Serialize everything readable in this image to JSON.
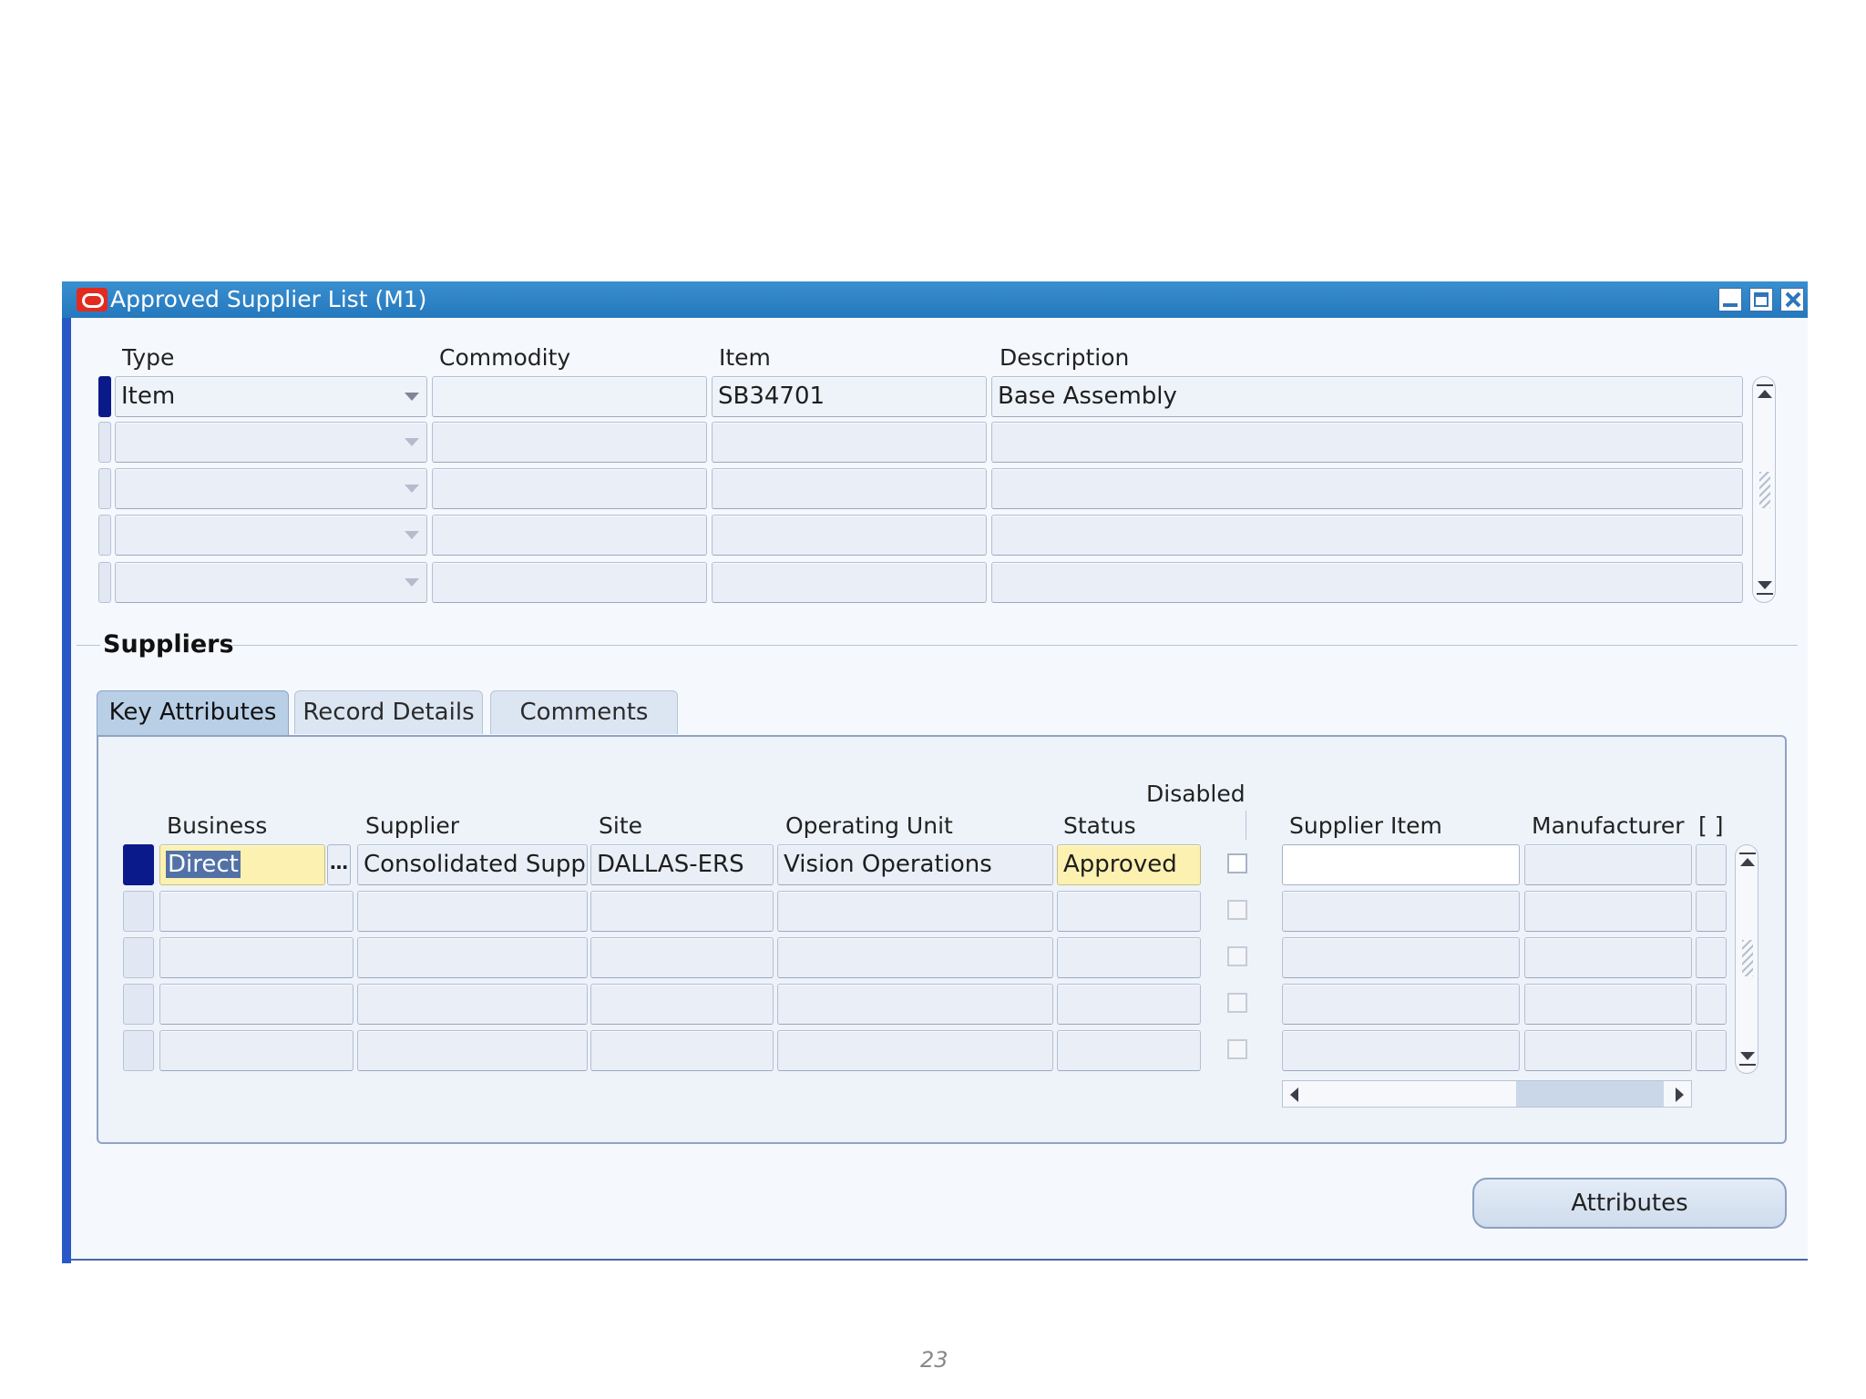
{
  "window": {
    "title": "Approved Supplier List (M1)"
  },
  "top_block": {
    "columns": {
      "type": "Type",
      "commodity": "Commodity",
      "item": "Item",
      "description": "Description"
    },
    "rows": [
      {
        "type": "Item",
        "commodity": "",
        "item": "SB34701",
        "description": "Base Assembly"
      },
      {
        "type": "",
        "commodity": "",
        "item": "",
        "description": ""
      },
      {
        "type": "",
        "commodity": "",
        "item": "",
        "description": ""
      },
      {
        "type": "",
        "commodity": "",
        "item": "",
        "description": ""
      },
      {
        "type": "",
        "commodity": "",
        "item": "",
        "description": ""
      }
    ]
  },
  "suppliers": {
    "section_title": "Suppliers",
    "tabs": [
      "Key Attributes",
      "Record Details",
      "Comments"
    ],
    "active_tab": "Key Attributes",
    "columns": {
      "business": "Business",
      "supplier": "Supplier",
      "site": "Site",
      "operating_unit": "Operating Unit",
      "status": "Status",
      "disabled": "Disabled",
      "supplier_item": "Supplier Item",
      "manufacturer": "Manufacturer",
      "extra": "[ ]"
    },
    "lov_glyph": "…",
    "rows": [
      {
        "business": "Direct",
        "supplier": "Consolidated Suppli",
        "site": "DALLAS-ERS",
        "operating_unit": "Vision Operations",
        "status": "Approved",
        "disabled": false,
        "supplier_item": "",
        "manufacturer": ""
      },
      {
        "business": "",
        "supplier": "",
        "site": "",
        "operating_unit": "",
        "status": "",
        "disabled": false,
        "supplier_item": "",
        "manufacturer": ""
      },
      {
        "business": "",
        "supplier": "",
        "site": "",
        "operating_unit": "",
        "status": "",
        "disabled": false,
        "supplier_item": "",
        "manufacturer": ""
      },
      {
        "business": "",
        "supplier": "",
        "site": "",
        "operating_unit": "",
        "status": "",
        "disabled": false,
        "supplier_item": "",
        "manufacturer": ""
      },
      {
        "business": "",
        "supplier": "",
        "site": "",
        "operating_unit": "",
        "status": "",
        "disabled": false,
        "supplier_item": "",
        "manufacturer": ""
      }
    ]
  },
  "buttons": {
    "attributes": "Attributes"
  },
  "page_number": "23",
  "colors": {
    "title_bar": "#2a80c4",
    "active_row": "#0b1a8a",
    "required_field": "#fcf1b0",
    "frame_accent": "#2a57c6"
  },
  "icons": [
    "oracle-logo-icon",
    "minimize-icon",
    "maximize-icon",
    "close-icon",
    "dropdown-arrow-icon",
    "scroll-up-icon",
    "scroll-down-icon",
    "scroll-left-icon",
    "scroll-right-icon",
    "list-of-values-icon"
  ]
}
